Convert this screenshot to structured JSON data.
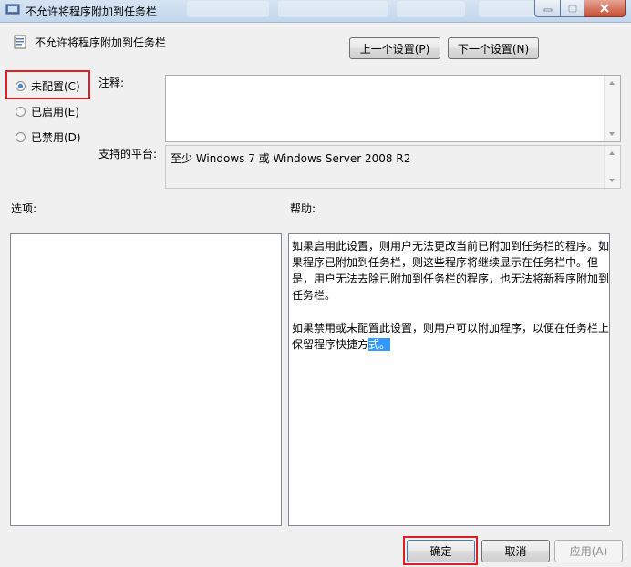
{
  "window": {
    "title": "不允许将程序附加到任务栏"
  },
  "header": {
    "title": "不允许将程序附加到任务栏",
    "prev_button": "上一个设置(P)",
    "next_button": "下一个设置(N)"
  },
  "options": {
    "radios": [
      {
        "label": "未配置(C)",
        "checked": true
      },
      {
        "label": "已启用(E)",
        "checked": false
      },
      {
        "label": "已禁用(D)",
        "checked": false
      }
    ]
  },
  "comment": {
    "label": "注释:",
    "value": ""
  },
  "platform": {
    "label": "支持的平台:",
    "value": "至少 Windows 7 或 Windows Server 2008 R2"
  },
  "sections": {
    "options_label": "选项:",
    "help_label": "帮助:"
  },
  "help": {
    "paragraph1": "如果启用此设置，则用户无法更改当前已附加到任务栏的程序。如果程序已附加到任务栏，则这些程序将继续显示在任务栏中。但是，用户无法去除已附加到任务栏的程序，也无法将新程序附加到任务栏。",
    "paragraph2_main": "如果禁用或未配置此设置，则用户可以附加程序，以便在任务栏上保留程序快捷方",
    "paragraph2_selected": "式。"
  },
  "footer": {
    "ok_button": "确定",
    "cancel_button": "取消",
    "apply_button": "应用(A)"
  },
  "colors": {
    "highlight_box": "#e02020",
    "selection": "#3399ff"
  },
  "icons": {
    "title": "policy-icon",
    "header": "policy-setting-icon"
  }
}
